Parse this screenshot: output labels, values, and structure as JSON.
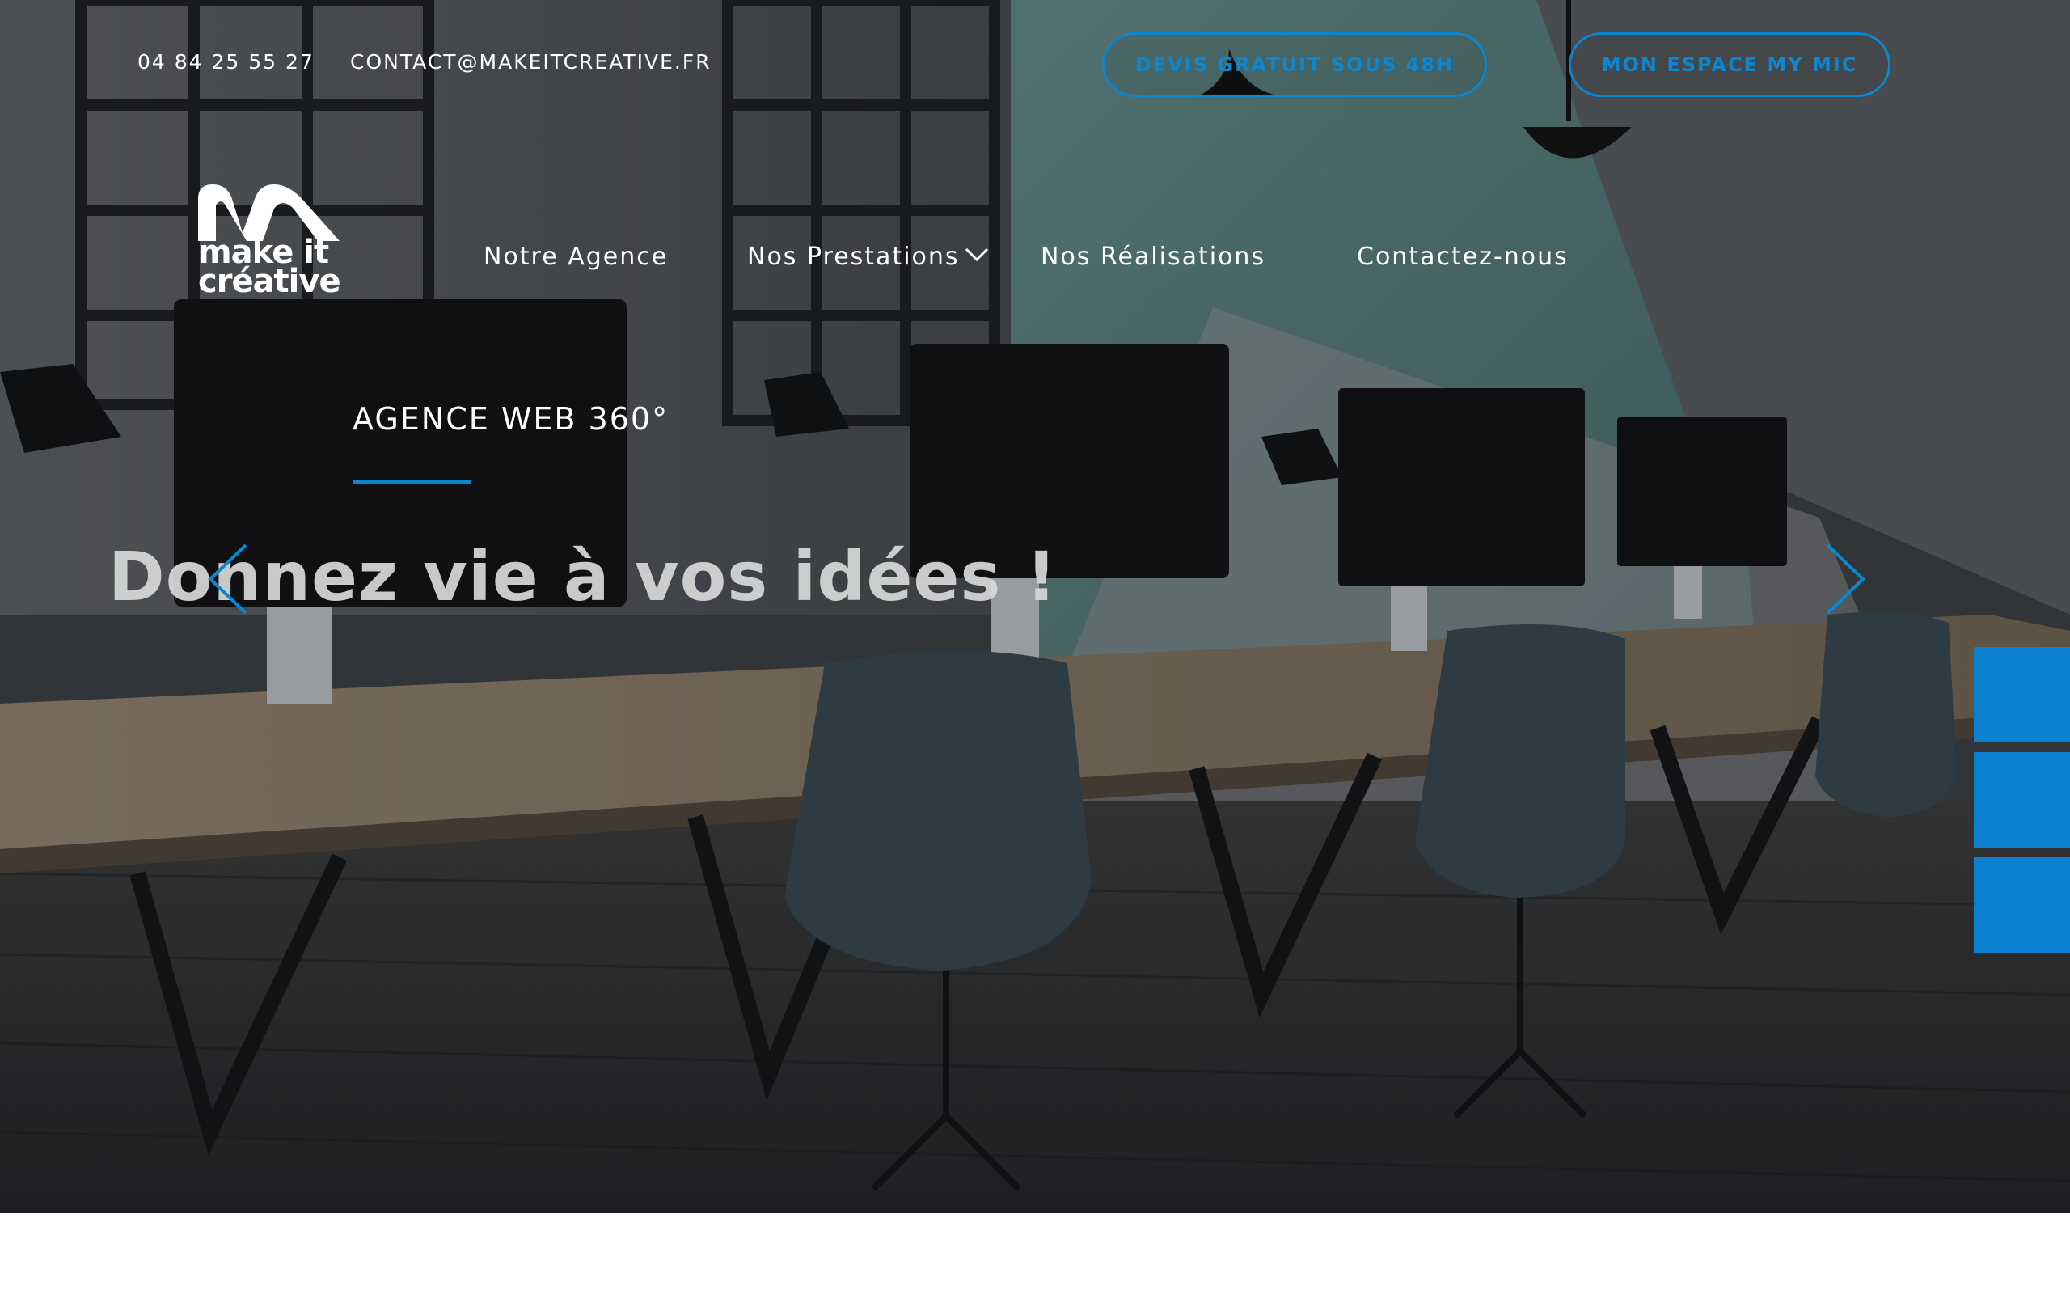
{
  "topbar": {
    "phone": "04 84 25 55 27",
    "email": "CONTACT@MAKEITCREATIVE.FR",
    "devis_label": "DEVIS GRATUIT SOUS 48H",
    "espace_label": "MON ESPACE MY MIC"
  },
  "logo": {
    "line1": "make it",
    "line2": "créative"
  },
  "nav": {
    "items": [
      {
        "label": "Notre Agence"
      },
      {
        "label": "Nos Prestations"
      },
      {
        "label": "Nos Réalisations"
      },
      {
        "label": "Contactez-nous"
      }
    ]
  },
  "hero": {
    "eyebrow": "AGENCE WEB 360°",
    "headline": "Donnez vie à vos idées !"
  },
  "icons": {
    "dropdown": "chevron-down-icon",
    "prev": "chevron-left-icon",
    "next": "chevron-right-icon"
  },
  "colors": {
    "accent": "#0b86d1",
    "side_tab": "#0b7fd0",
    "text": "#ffffff"
  }
}
